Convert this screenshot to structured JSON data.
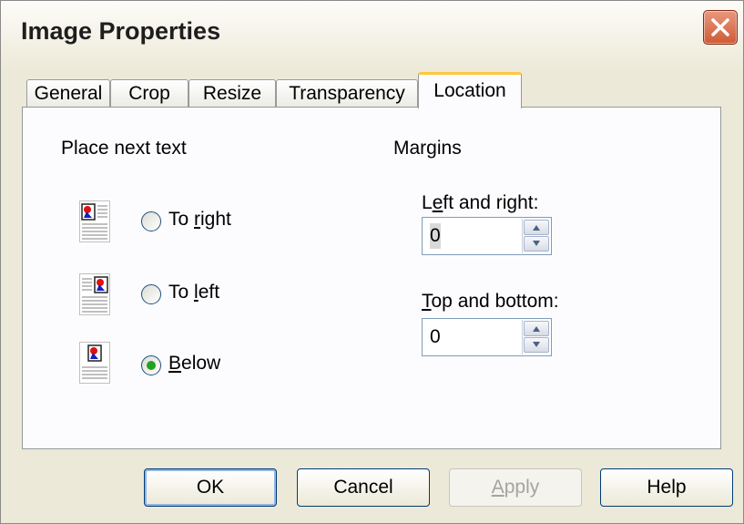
{
  "window": {
    "title": "Image Properties"
  },
  "tabs": [
    "General",
    "Crop",
    "Resize",
    "Transparency",
    "Location"
  ],
  "active_tab": "Location",
  "place_next_text": {
    "heading": "Place next text",
    "options": [
      {
        "label": "To right",
        "accel": "r",
        "selected": false
      },
      {
        "label": "To left",
        "accel": "l",
        "selected": false
      },
      {
        "label": "Below",
        "accel": "B",
        "selected": true
      }
    ]
  },
  "margins": {
    "heading": "Margins",
    "left_right": {
      "label": "Left and right:",
      "value": "0"
    },
    "top_bottom": {
      "label": "Top and bottom:",
      "value": "0"
    }
  },
  "buttons": {
    "ok": "OK",
    "cancel": "Cancel",
    "apply": "Apply",
    "help": "Help"
  }
}
